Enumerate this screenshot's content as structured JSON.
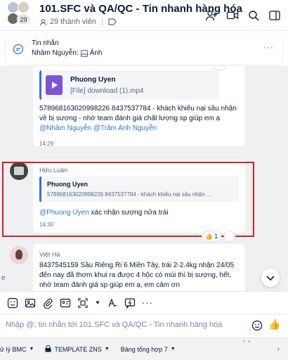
{
  "header": {
    "title": "101.SFC và QA/QC - Tin nhanh hàng hóa",
    "member_count_badge": "29",
    "members_text": "29 thành viên"
  },
  "pinned": {
    "title": "Tin nhắn",
    "preview_author": "Nhâm Nguyễn:",
    "preview_content": "Ảnh"
  },
  "messages": [
    {
      "file": {
        "name": "Phuong Uyen",
        "info": "[File] download (1).mp4"
      },
      "text_before": "578968163020998226 8437537784 - khách khiếu nại sầu nhận về bị sượng - nhờ team đánh giá chất lượng sp giúp em ạ ",
      "mention1": "@Nhâm Nguyễn",
      "mention2": "@Trâm Anh Nguyễn",
      "time": "14:29"
    },
    {
      "sender": "Hữu Luân",
      "quote_name": "Phuong Uyen",
      "quote_text": "578968163020998226 8437537784 - khách khiếu nại sầu nhận ...",
      "mention": "@Phuong Uyen",
      "text_after": " xác nhận sượng nửa trái",
      "time": "14:30",
      "reaction_count": "1"
    },
    {
      "sender": "Việt Hà",
      "text": "8437545159  Sầu Riêng Ri 6 Miền Tây, trái 2-2.4kg nhận 24/05 đến nay đã thơm khui ra được 4 hộc có múi thì bị sượng, hết, nhờ team đánh giá sp giúp em ạ, em cảm ơn"
    }
  ],
  "edge_char": "e",
  "composer": {
    "placeholder": "Nhập @, tin nhắn tới 101.SFC và QA/QC - Tin nhanh hàng hóa"
  },
  "bottom_bar": {
    "items": [
      "ử lý BMC",
      "TEMPLATE ZNS",
      "Bảng tổng hợp 7"
    ]
  },
  "colors": {
    "accent": "#2e76d9",
    "highlight_border": "#d91f26",
    "chat_bg": "#eef0f1",
    "file_icon": "#7b53d6"
  }
}
